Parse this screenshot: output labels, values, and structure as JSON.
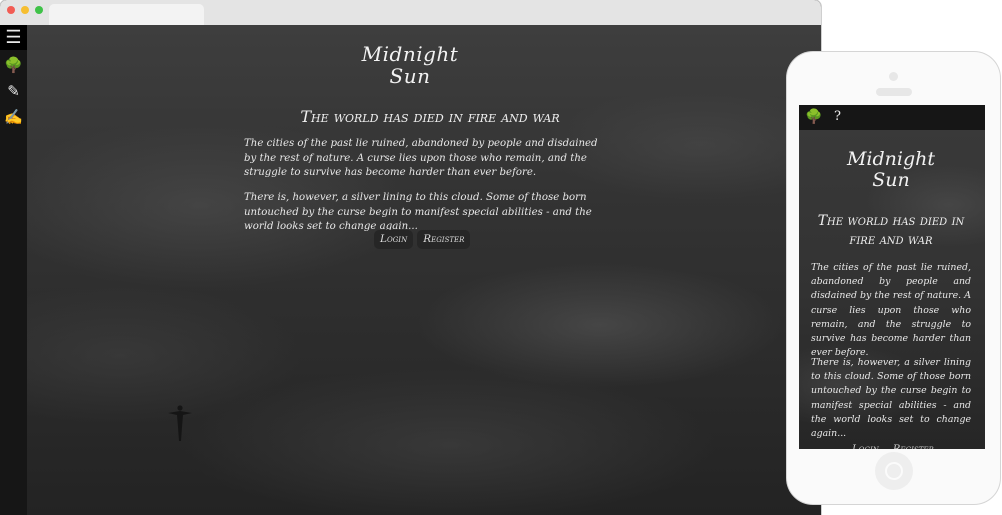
{
  "desktop": {
    "sidebar": {
      "menu_icon": "☰",
      "items": [
        {
          "name": "tree-icon",
          "glyph": "🌳"
        },
        {
          "name": "quill-icon",
          "glyph": "✎"
        },
        {
          "name": "edit-icon",
          "glyph": "✍"
        }
      ]
    },
    "logo": {
      "line1": "Midnight",
      "line2": "Sun"
    },
    "headline": "The world has died in fire and war",
    "paragraphs": [
      "The cities of the past lie ruined, abandoned by people and disdained by the rest of nature. A curse lies upon those who remain, and the struggle to survive has become harder than ever before.",
      "There is, however, a silver lining to this cloud. Some of those born untouched by the curse begin to manifest special abilities - and the world looks set to change again..."
    ],
    "buttons": {
      "login": "Login",
      "register": "Register"
    }
  },
  "mobile": {
    "topbar": {
      "tree_icon": "🌳",
      "help": "?"
    },
    "logo": {
      "line1": "Midnight",
      "line2": "Sun"
    },
    "headline": "The world has died in fire and war",
    "paragraphs": [
      "The cities of the past lie ruined, abandoned by people and disdained by the rest of nature. A curse lies upon those who remain, and the struggle to survive has become harder than ever before.",
      "There is, however, a silver lining to this cloud. Some of those born untouched by the curse begin to manifest special abilities - and the world looks set to change again..."
    ],
    "buttons": {
      "login": "Login",
      "register": "Register"
    }
  },
  "colors": {
    "accent_text": "#f0f0f0",
    "sidebar": "#161616",
    "button": "#262626"
  }
}
